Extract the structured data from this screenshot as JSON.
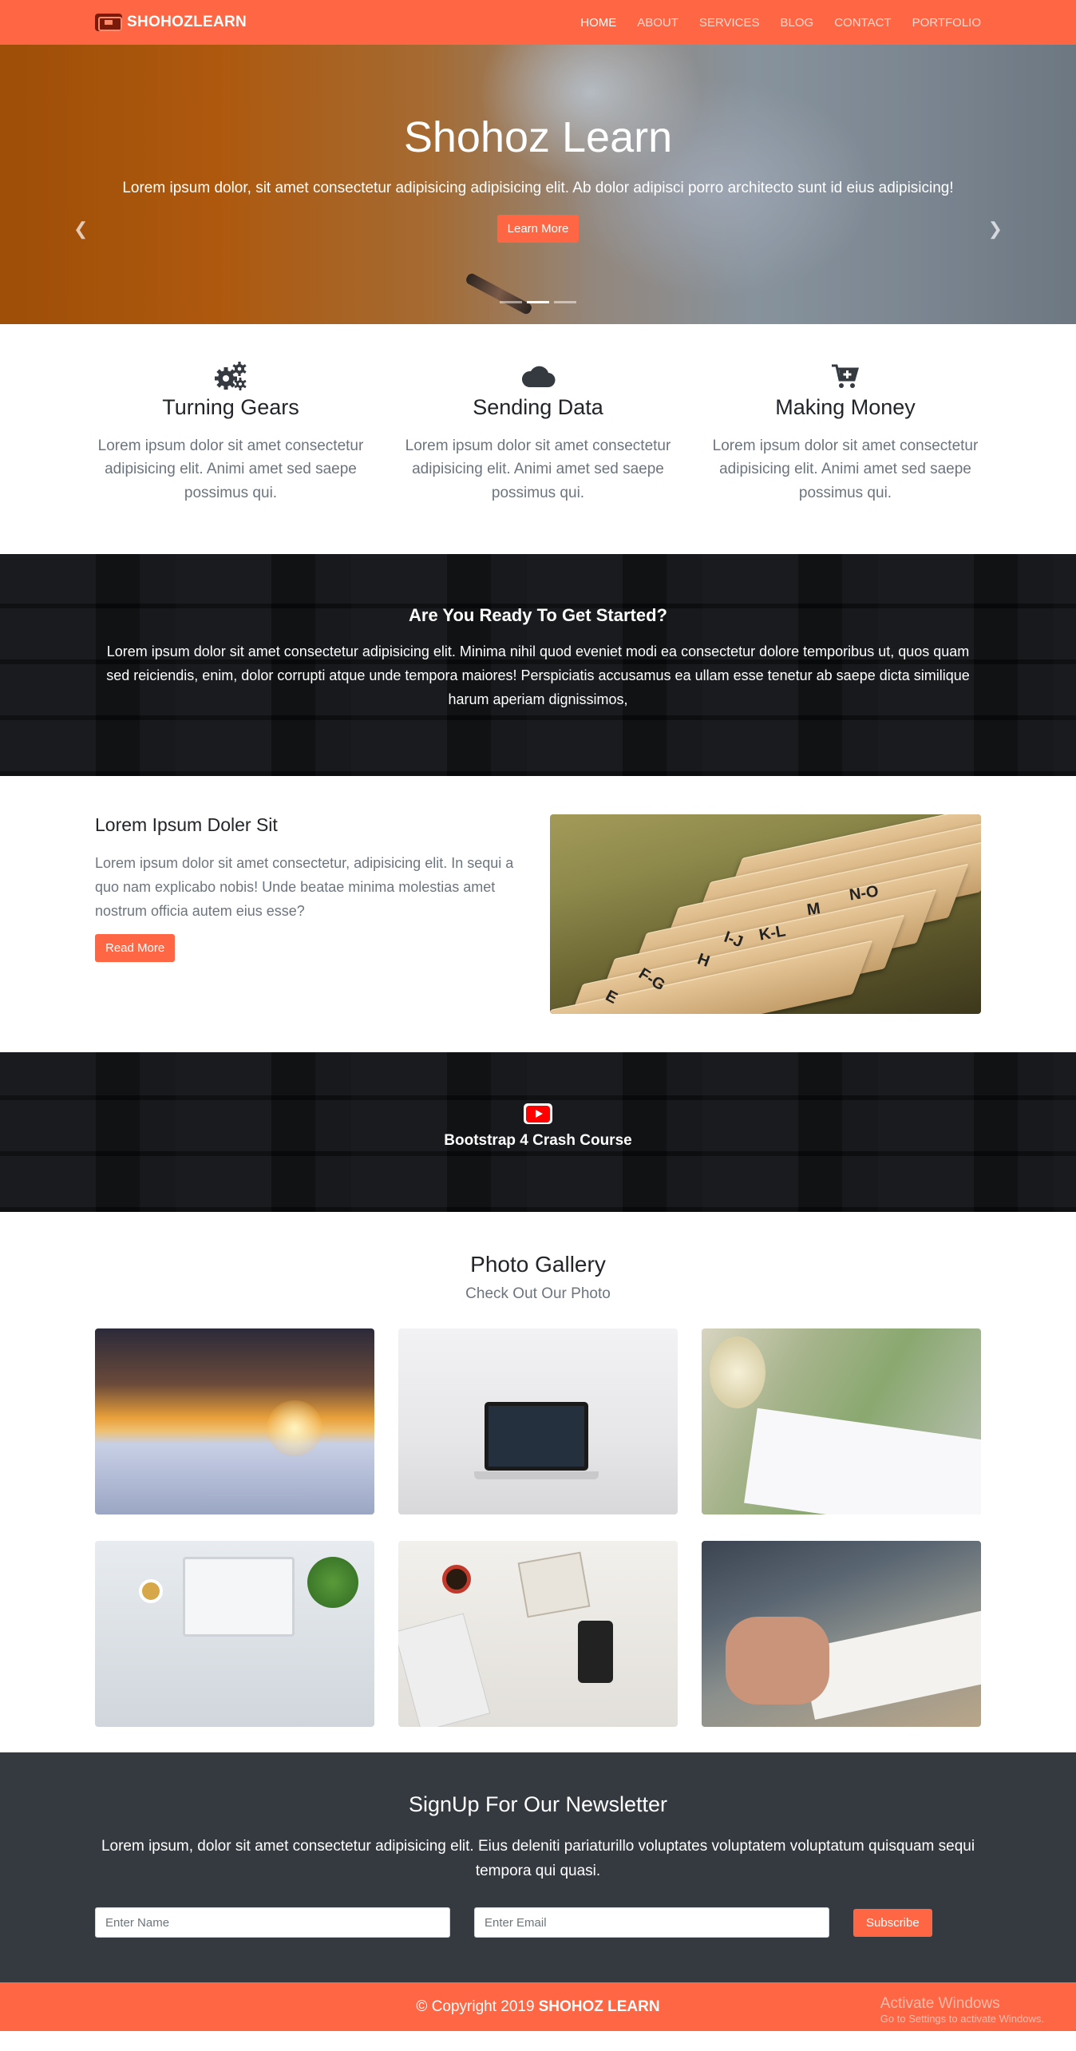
{
  "navbar": {
    "brand_prefix": "SHOHOZ",
    "brand_suffix": "LEARN",
    "links": [
      "HOME",
      "ABOUT",
      "SERVICES",
      "BLOG",
      "CONTACT",
      "PORTFOLIO"
    ],
    "active": "HOME"
  },
  "hero": {
    "title": "Shohoz Learn",
    "text": "Lorem ipsum dolor, sit amet consectetur adipisicing adipisicing elit. Ab dolor adipisci porro architecto sunt id eius adipisicing!",
    "button": "Learn More",
    "prev_icon": "chevron-left-icon",
    "next_icon": "chevron-right-icon",
    "active_indicator": 1
  },
  "features": [
    {
      "icon": "cogs-icon",
      "title": "Turning Gears",
      "text": "Lorem ipsum dolor sit amet consectetur adipisicing elit. Animi amet sed saepe possimus qui."
    },
    {
      "icon": "cloud-icon",
      "title": "Sending Data",
      "text": "Lorem ipsum dolor sit amet consectetur adipisicing elit. Animi amet sed saepe possimus qui."
    },
    {
      "icon": "cart-plus-icon",
      "title": "Making Money",
      "text": "Lorem ipsum dolor sit amet consectetur adipisicing elit. Animi amet sed saepe possimus qui."
    }
  ],
  "started": {
    "title": "Are You Ready To Get Started?",
    "text": "Lorem ipsum dolor sit amet consectetur adipisicing elit. Minima nihil quod eveniet modi ea consectetur dolore temporibus ut, quos quam sed reiciendis, enim, dolor corrupti atque unde tempora maiores! Perspiciatis accusamus ea ullam esse tenetur ab saepe dicta similique harum aperiam dignissimos,"
  },
  "info": {
    "title": "Lorem Ipsum Doler Sit",
    "text": "Lorem ipsum dolor sit amet consectetur, adipisicing elit. In sequi a quo nam explicabo nobis! Unde beatae minima molestias amet nostrum officia autem eius esse?",
    "button": "Read More",
    "folder_tabs": [
      "N-O",
      "M",
      "K-L",
      "I-J",
      "H",
      "F-G",
      "E"
    ]
  },
  "video": {
    "icon": "youtube-icon",
    "title": "Bootstrap 4 Crash Course"
  },
  "gallery": {
    "title": "Photo Gallery",
    "subtitle": "Check Out Our Photo"
  },
  "newsletter": {
    "title": "SignUp For Our Newsletter",
    "text": "Lorem ipsum, dolor sit amet consectetur adipisicing elit. Eius deleniti pariaturillo voluptates voluptatem voluptatum quisquam sequi tempora qui quasi.",
    "name_placeholder": "Enter Name",
    "email_placeholder": "Enter Email",
    "button": "Subscribe"
  },
  "footer": {
    "copyright": "© Copyright 2019",
    "brand": "SHOHOZ LEARN",
    "watermark_line1": "Activate Windows",
    "watermark_line2": "Go to Settings to activate Windows."
  },
  "colors": {
    "accent": "#ff6644",
    "dark": "#343a40"
  }
}
